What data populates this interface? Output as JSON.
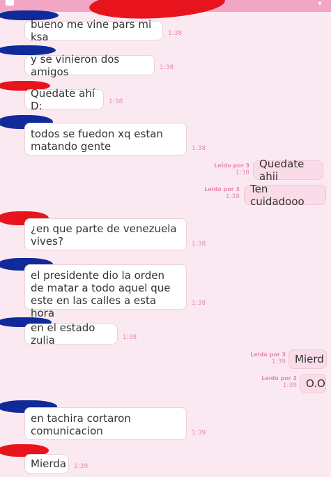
{
  "header": {
    "menu_icon": "document-icon",
    "dropdown_icon": "chevron-down-icon"
  },
  "colors": {
    "background": "#fbe9f1",
    "header": "#f3a6c4",
    "accent_pink": "#e88aae",
    "scribble_red": "#e8141d",
    "scribble_blue": "#102a9a"
  },
  "messages": [
    {
      "dir": "in",
      "text": "bueno me vine pars mi ksa",
      "time": "1:38"
    },
    {
      "dir": "in",
      "text": "y se vinieron dos amigos",
      "time": "1:38"
    },
    {
      "dir": "in",
      "text": "Quedate ahí D:",
      "time": "1:38"
    },
    {
      "dir": "in",
      "text": "todos se fuedon xq estan matando gente",
      "time": "1:38"
    },
    {
      "dir": "out",
      "text": "Quedate ahii",
      "read": "Leído por 3",
      "time": "1:38"
    },
    {
      "dir": "out",
      "text": "Ten cuidadooo",
      "read": "Leído por 3",
      "time": "1:38"
    },
    {
      "dir": "in",
      "text": "¿en que parte de venezuela vives?",
      "time": "1:38"
    },
    {
      "dir": "in",
      "text": "el presidente dio la orden de matar a todo aquel que este en las calles a esta hora",
      "time": "1:38"
    },
    {
      "dir": "in",
      "text": "en el estado zulia",
      "time": "1:38"
    },
    {
      "dir": "out",
      "text": "Mierd",
      "read": "Leído por 3",
      "time": "1:39"
    },
    {
      "dir": "out",
      "text": "O.O",
      "read": "Leído por 3",
      "time": "1:39"
    },
    {
      "dir": "in",
      "text": "en tachira cortaron comunicacion",
      "time": "1:39"
    },
    {
      "dir": "in",
      "text": "Mierda",
      "time": "1:39"
    }
  ]
}
